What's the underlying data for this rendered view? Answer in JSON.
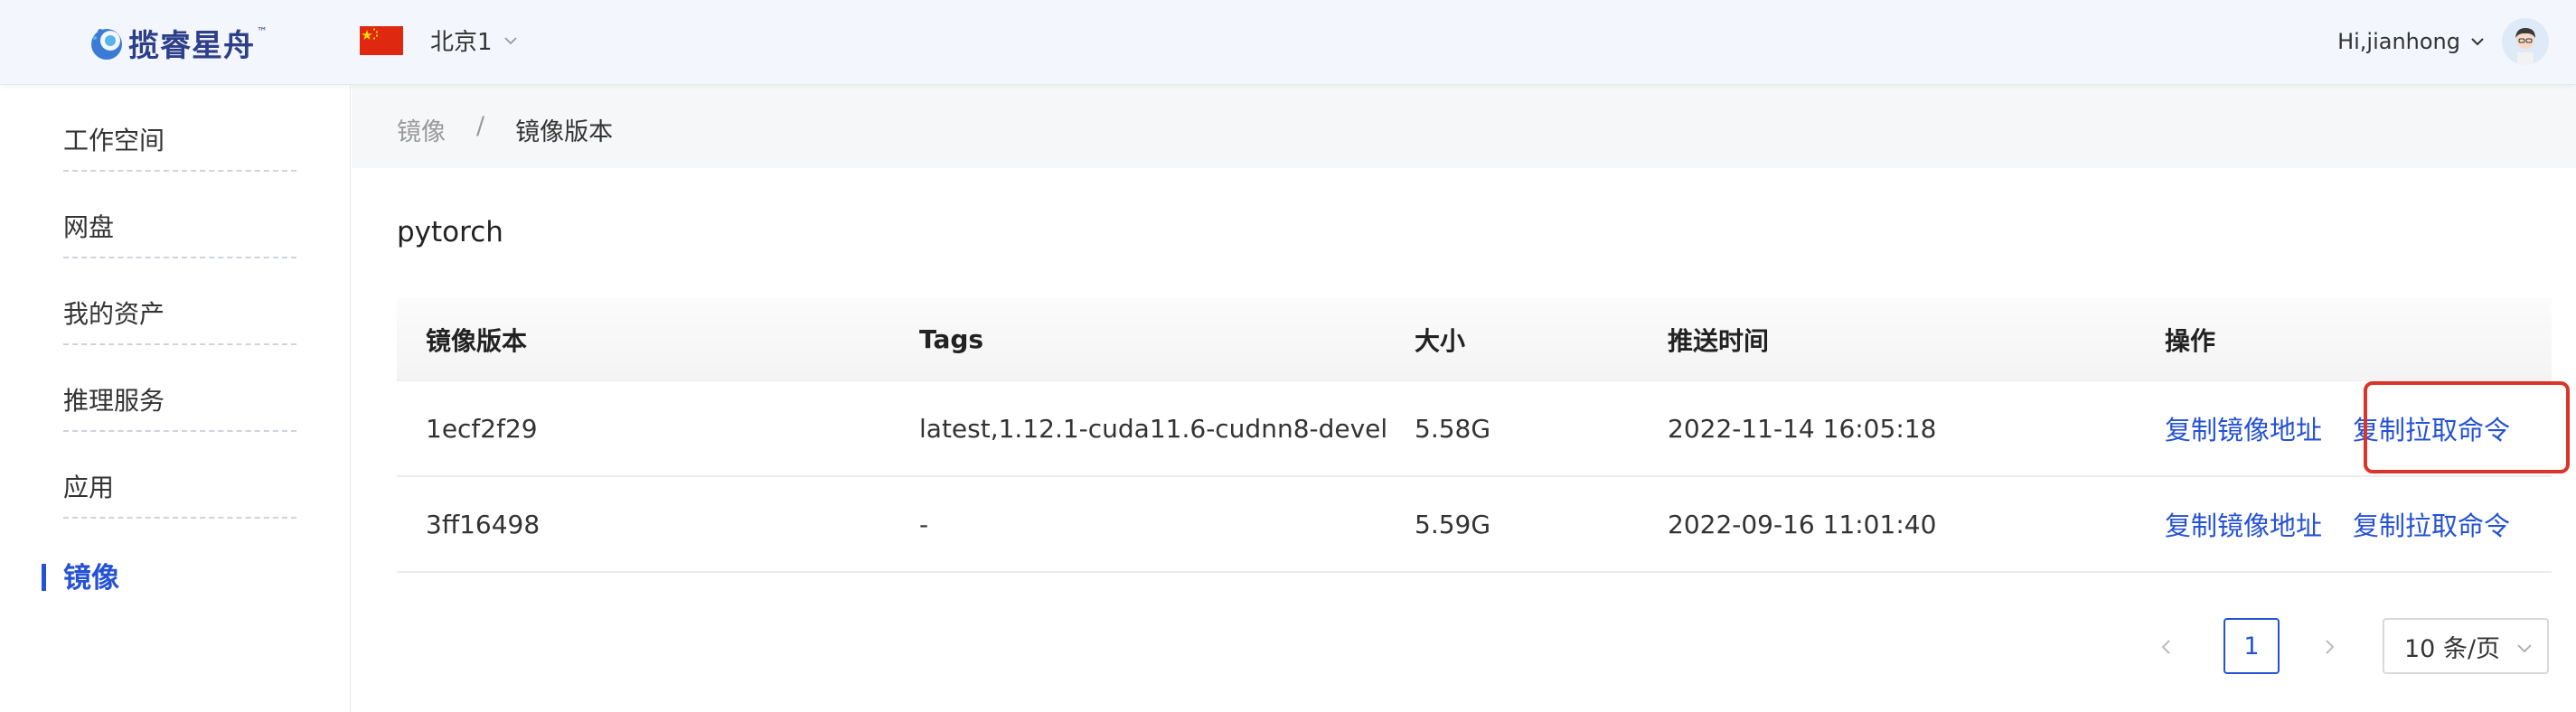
{
  "header": {
    "logo_text": "揽睿星舟",
    "logo_tm": "™",
    "region": "北京1",
    "region_flag": "china-flag-icon",
    "user_greeting": "Hi,jianhong"
  },
  "sidebar": {
    "items": [
      {
        "label": "工作空间",
        "active": false
      },
      {
        "label": "网盘",
        "active": false
      },
      {
        "label": "我的资产",
        "active": false
      },
      {
        "label": "推理服务",
        "active": false
      },
      {
        "label": "应用",
        "active": false
      },
      {
        "label": "镜像",
        "active": true
      }
    ]
  },
  "breadcrumb": {
    "parent": "镜像",
    "separator": "/",
    "current": "镜像版本"
  },
  "page_title": "pytorch",
  "table": {
    "headers": [
      "镜像版本",
      "Tags",
      "大小",
      "推送时间",
      "操作"
    ],
    "rows": [
      {
        "version": "1ecf2f29",
        "tags": "latest,1.12.1-cuda11.6-cudnn8-devel",
        "size": "5.58G",
        "time": "2022-11-14 16:05:18",
        "op_copy_addr": "复制镜像地址",
        "op_copy_pull": "复制拉取命令"
      },
      {
        "version": "3ff16498",
        "tags": "-",
        "size": "5.59G",
        "time": "2022-09-16 11:01:40",
        "op_copy_addr": "复制镜像地址",
        "op_copy_pull": "复制拉取命令"
      }
    ]
  },
  "pagination": {
    "current_page": "1",
    "page_size": "10 条/页"
  },
  "colors": {
    "accent": "#2552d4",
    "highlight_box": "#d9362b"
  }
}
